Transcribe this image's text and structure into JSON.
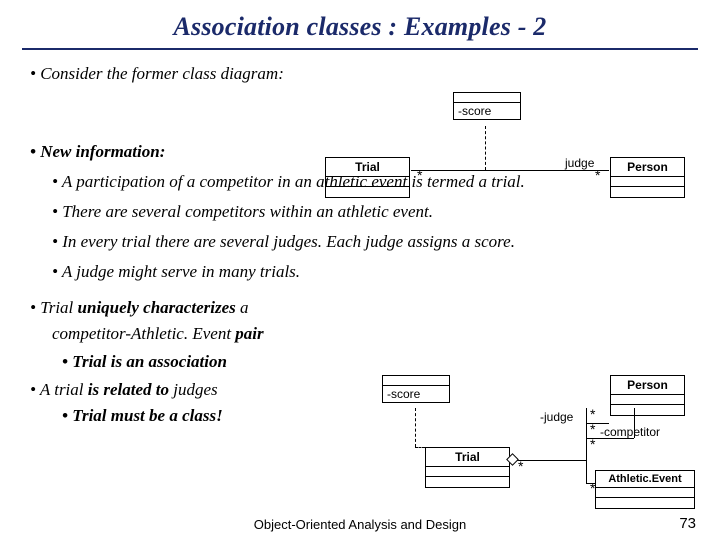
{
  "title": "Association classes : Examples - 2",
  "bullets": {
    "consider": "• Consider the former class diagram:",
    "newinfo": "• New information:",
    "sub1": "• A participation of a competitor in an athletic event is termed a trial.",
    "sub2": "• There are several competitors within an athletic event.",
    "sub3": "• In every trial there are several judges. Each judge assigns a score.",
    "sub4": "• A judge might serve in many trials."
  },
  "lower": {
    "l1a": "• Trial ",
    "l1b": "uniquely characterizes",
    "l1c": " a",
    "l2": "competitor-Athletic. Event ",
    "l2b": "pair",
    "l3": "• Trial is an association",
    "l4a": "• A trial ",
    "l4b": "is related to",
    "l4c": " judges",
    "l5": "• Trial must be a class!"
  },
  "uml": {
    "trial": "Trial",
    "person": "Person",
    "score": "-score",
    "judge": "judge",
    "judge_dash": "-judge",
    "competitor_dash": "-competitor",
    "athletic_event": "Athletic.Event",
    "star": "*"
  },
  "footer": "Object-Oriented Analysis and Design",
  "page": "73"
}
